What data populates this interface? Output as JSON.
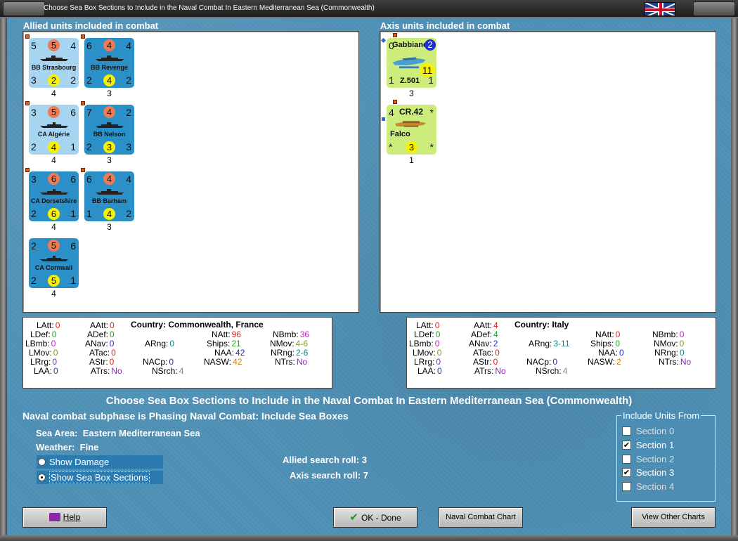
{
  "window": {
    "title": "Choose Sea Box Sections to Include in the Naval Combat In Eastern Mediterranean Sea (Commonwealth)"
  },
  "allied": {
    "header": "Allied units included in combat",
    "units": [
      {
        "name": "BB Strasbourg",
        "tl": "5",
        "circle": "5",
        "tr": "4",
        "bl": "3",
        "ycircle": "2",
        "br": "2",
        "count": "4"
      },
      {
        "name": "BB Revenge",
        "tl": "6",
        "circle": "4",
        "tr": "4",
        "bl": "2",
        "ycircle": "4",
        "br": "2",
        "count": "3"
      },
      {
        "name": "CA Algérie",
        "tl": "3",
        "circle": "5",
        "tr": "6",
        "bl": "2",
        "ycircle": "4",
        "br": "1",
        "count": "4"
      },
      {
        "name": "BB Nelson",
        "tl": "7",
        "circle": "4",
        "tr": "2",
        "bl": "2",
        "ycircle": "3",
        "br": "3",
        "count": "3"
      },
      {
        "name": "CA Dorsetshire",
        "tl": "3",
        "circle": "6",
        "tr": "6",
        "bl": "2",
        "ycircle": "6",
        "br": "1",
        "count": "4"
      },
      {
        "name": "BB Barham",
        "tl": "6",
        "circle": "4",
        "tr": "4",
        "bl": "1",
        "ycircle": "4",
        "br": "2",
        "count": "3"
      },
      {
        "name": "CA Cornwall",
        "tl": "2",
        "circle": "5",
        "tr": "6",
        "bl": "2",
        "ycircle": "5",
        "br": "1",
        "count": "4"
      }
    ]
  },
  "axis": {
    "header": "Axis units included in combat",
    "units": [
      {
        "name": "Gabbiano",
        "model": "Z.501",
        "tl": "0",
        "circle": "2",
        "big": "11",
        "bl": "1",
        "br": "1",
        "count": "3"
      },
      {
        "name": "Falco",
        "model": "CR.42",
        "tl": "4",
        "tr": "*",
        "bl": "*",
        "ycircle": "3",
        "br": "*",
        "count": "1"
      }
    ]
  },
  "allied_stats": {
    "country_label": "Country:",
    "country": "Commonwealth, France",
    "LAtt": "0",
    "LDef": "0",
    "LBmb": "0",
    "LMov": "0",
    "LRrg": "0",
    "LAA": "0",
    "AAtt": "0",
    "ADef": "0",
    "ANav": "0",
    "ATac": "0",
    "AStr": "0",
    "ATrs": "No",
    "ARng": "0",
    "NACp": "0",
    "NSrch": "4",
    "NAtt": "96",
    "Ships": "21",
    "NAA": "42",
    "NASW": "42",
    "NBmb": "36",
    "NMov": "4-6",
    "NRng": "2-6",
    "NTrs": "No"
  },
  "axis_stats": {
    "country_label": "Country:",
    "country": "Italy",
    "LAtt": "0",
    "LDef": "0",
    "LBmb": "0",
    "LMov": "0",
    "LRrg": "0",
    "LAA": "0",
    "AAtt": "4",
    "ADef": "4",
    "ANav": "2",
    "ATac": "0",
    "AStr": "0",
    "ATrs": "No",
    "ARng": "3-11",
    "NACp": "0",
    "NSrch": "4",
    "NAtt": "0",
    "Ships": "0",
    "NAA": "0",
    "NASW": "2",
    "NBmb": "0",
    "NMov": "0",
    "NRng": "0",
    "NTrs": "No"
  },
  "main": {
    "title": "Choose Sea Box Sections to Include in the Naval Combat In Eastern Mediterranean Sea (Commonwealth)",
    "subphase": "Naval combat subphase is Phasing Naval Combat: Include Sea Boxes",
    "sea_area_label": "Sea Area:",
    "sea_area": "Eastern Mediterranean Sea",
    "weather_label": "Weather:",
    "weather": "Fine",
    "radio_damage": "Show Damage",
    "radio_sections": "Show Sea Box Sections",
    "allied_roll_label": "Allied search roll:",
    "allied_roll": "3",
    "axis_roll_label": "Axis search roll:",
    "axis_roll": "7"
  },
  "include": {
    "legend": "Include Units From",
    "sections": [
      {
        "label": "Section 0",
        "checked": false
      },
      {
        "label": "Section 1",
        "checked": true
      },
      {
        "label": "Section 2",
        "checked": false
      },
      {
        "label": "Section 3",
        "checked": true
      },
      {
        "label": "Section 4",
        "checked": false
      }
    ]
  },
  "buttons": {
    "help": "Help",
    "ok": "OK - Done",
    "naval_chart": "Naval Combat Chart",
    "other_charts": "View Other Charts"
  }
}
